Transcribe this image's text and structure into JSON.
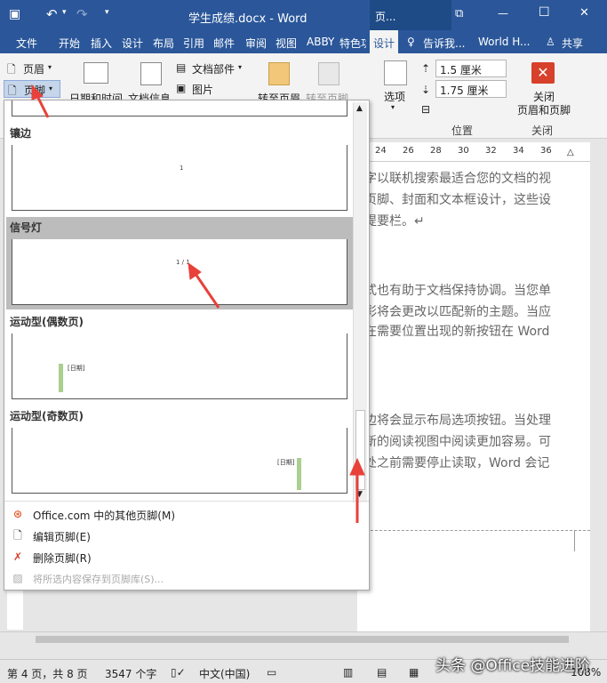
{
  "window": {
    "title": "学生成绩.docx - Word",
    "contextual_tab_group": "页...",
    "restore_glyph": "⧉",
    "minimize_glyph": "—",
    "maximize_glyph": "☐",
    "close_glyph": "✕"
  },
  "qat": {
    "save": "▣",
    "undo": "↶",
    "undo_drop": "▾",
    "redo": "↷",
    "customize": "▾"
  },
  "tabs": [
    "文件",
    "开始",
    "插入",
    "设计",
    "布局",
    "引用",
    "邮件",
    "审阅",
    "视图",
    "ABBY",
    "特色功",
    "设计"
  ],
  "tell_me": "告诉我...",
  "account": "World H...",
  "share": "共享",
  "ribbon": {
    "header_btn": "页眉",
    "footer_btn": "页脚",
    "datetime": "日期和时间",
    "docinfo": "文档信息",
    "doc_parts": "文档部件",
    "picture": "图片",
    "goto_header": "转至页眉",
    "goto_footer": "转至页脚",
    "options": "选项",
    "header_from_top": "1.5 厘米",
    "footer_from_bottom": "1.75 厘米",
    "group_position": "位置",
    "close_btn": "关闭\n页眉和页脚",
    "group_close": "关闭"
  },
  "ruler": [
    "24",
    "26",
    "28",
    "30",
    "32",
    "34",
    "36"
  ],
  "document": {
    "lines": [
      "字以联机搜索最适合您的文档的视",
      "页脚、封面和文本框设计，这些设",
      "提要栏。↵",
      "",
      "",
      "式也有助于文档保持协调。当您单",
      "彩将会更改以匹配新的主题。当应",
      "在需要位置出现的新按钮在 Word",
      "",
      "",
      "",
      "边将会显示布局选项按钮。当处理",
      "新的阅读视图中阅读更加容易。可",
      "处之前需要停止读取，Word 会记"
    ]
  },
  "gallery": {
    "sections": [
      {
        "name": "镶边",
        "thumb_text": "1"
      },
      {
        "name": "信号灯",
        "thumb_text": "1 / 1"
      },
      {
        "name": "运动型(偶数页)",
        "thumb_text": "[日期]"
      },
      {
        "name": "运动型(奇数页)",
        "thumb_text": "[日期]"
      }
    ],
    "menu": [
      {
        "label": "Office.com 中的其他页脚(M)",
        "icon": "office-icon",
        "enabled": true
      },
      {
        "label": "编辑页脚(E)",
        "icon": "edit-page-icon",
        "enabled": true
      },
      {
        "label": "删除页脚(R)",
        "icon": "delete-x-icon",
        "enabled": true
      },
      {
        "label": "将所选内容保存到页脚库(S)...",
        "icon": "save-gallery-icon",
        "enabled": false
      }
    ]
  },
  "status": {
    "page": "第 4 页，共 8 页",
    "words": "3547 个字",
    "lang": "中文(中国)",
    "zoom": "108%"
  },
  "watermark": "头条 @Office技能进阶",
  "colors": {
    "accent": "#2b579a",
    "close_red": "#d7402b",
    "arrow": "#e8413a"
  }
}
